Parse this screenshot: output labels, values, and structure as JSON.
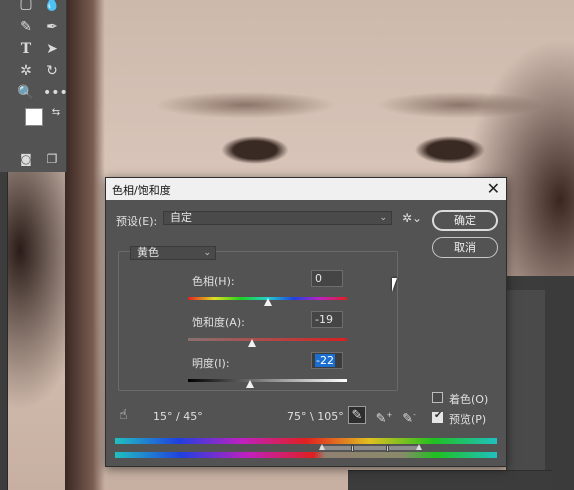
{
  "dialog": {
    "title": "色相/饱和度",
    "close_glyph": "✕",
    "preset_label": "预设(E):",
    "preset_value": "自定",
    "channel_value": "黄色",
    "hue": {
      "label": "色相(H):",
      "value": "0",
      "level": 0.5
    },
    "saturation": {
      "label": "饱和度(A):",
      "value": "-19",
      "level": 0.405
    },
    "lightness": {
      "label": "明度(I):",
      "value": "-22",
      "level": 0.39
    },
    "range_left": "15° / 45°",
    "range_right": "75° \\ 105°",
    "ok_label": "确定",
    "cancel_label": "取消",
    "colorize_label": "着色(O)",
    "colorize_checked": false,
    "preview_label": "预览(P)",
    "preview_checked": true
  },
  "icons": {
    "gear": "gear-icon",
    "hand": "hand-icon",
    "eyedropper": "eyedropper-icon",
    "eyedropper_plus": "eyedropper-plus-icon",
    "eyedropper_minus": "eyedropper-minus-icon"
  },
  "colors": {
    "dialog_bg": "#535353",
    "selection": "#1a6ed0"
  }
}
